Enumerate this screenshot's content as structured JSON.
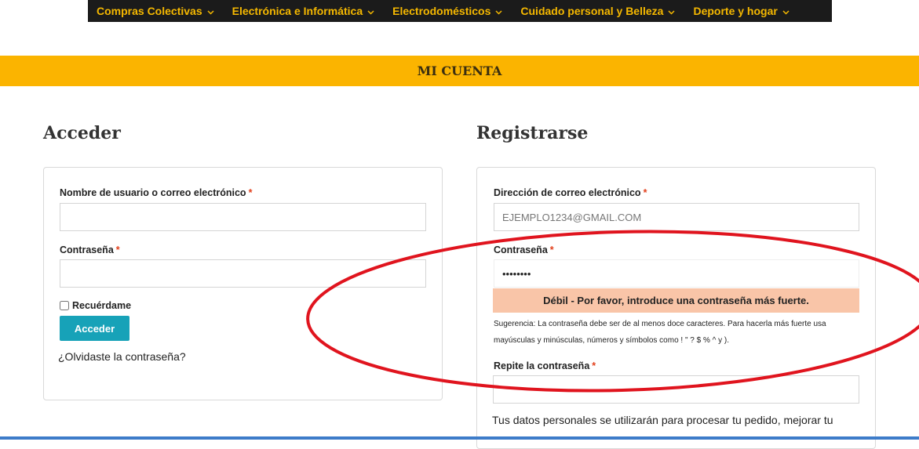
{
  "nav": {
    "items": [
      {
        "label": "Compras Colectivas"
      },
      {
        "label": "Electrónica e Informática"
      },
      {
        "label": "Electrodomésticos"
      },
      {
        "label": "Cuidado personal y Belleza"
      },
      {
        "label": "Deporte y hogar"
      }
    ],
    "chevron": "⌄"
  },
  "banner": {
    "title": "MI CUENTA"
  },
  "login": {
    "title": "Acceder",
    "username_label": "Nombre de usuario o correo electrónico",
    "password_label": "Contraseña",
    "required_mark": "*",
    "remember_label": "Recuérdame",
    "submit_label": "Acceder",
    "forgot_link": "¿Olvidaste la contraseña?"
  },
  "register": {
    "title": "Registrarse",
    "email_label": "Dirección de correo electrónico",
    "email_value": "EJEMPLO1234@GMAIL.COM",
    "password_label": "Contraseña",
    "password_value": "••••••••",
    "strength_message": "Débil - Por favor, introduce una contraseña más fuerte.",
    "hint_line1": "Sugerencia: La contraseña debe ser de al menos doce caracteres. Para hacerla más fuerte usa",
    "hint_line2": "mayúsculas y minúsculas, números y símbolos como ! \" ? $ % ^ y ).",
    "repeat_label": "Repite la contraseña",
    "required_mark": "*",
    "privacy_text": "Tus datos personales se utilizarán para procesar tu pedido, mejorar tu"
  },
  "colors": {
    "accent": "#fbb400",
    "nav_text": "#f5b800",
    "button": "#17a2b8",
    "strength_bg": "#f9c5a8",
    "annotation": "#e0141e"
  }
}
